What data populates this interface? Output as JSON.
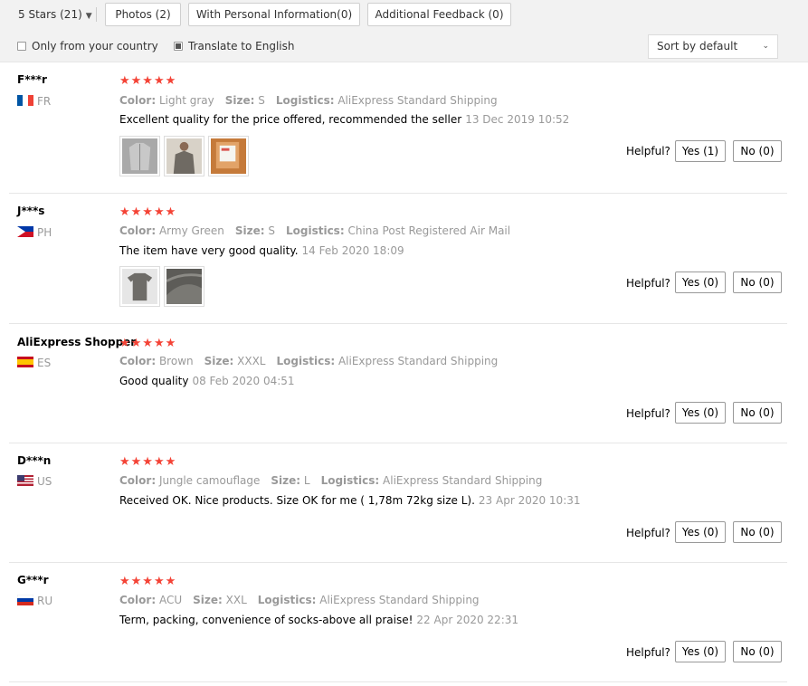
{
  "filters": {
    "star_filter": "5 Stars (21)",
    "buttons": [
      "Photos (2)",
      "With Personal Information(0)",
      "Additional Feedback (0)"
    ],
    "only_country": "Only from your country",
    "only_country_checked": false,
    "translate": "Translate to English",
    "translate_checked": true,
    "sort": "Sort by default"
  },
  "labels": {
    "color": "Color:",
    "size": "Size:",
    "logistics": "Logistics:",
    "helpful": "Helpful?"
  },
  "colors": {
    "star": "#f44336",
    "text_muted": "#999999"
  },
  "reviews": [
    {
      "name": "F***r",
      "country": "FR",
      "rating": 5,
      "stars": "★★★★★",
      "color": "Light gray",
      "size": "S",
      "logistics": "AliExpress Standard Shipping",
      "text": "Excellent quality for the price offered, recommended the seller",
      "date": "13 Dec 2019 10:52",
      "photos": [
        "photo-gray-jacket",
        "photo-person-sweater",
        "photo-package"
      ],
      "yes": "Yes (1)",
      "no": "No (0)"
    },
    {
      "name": "J***s",
      "country": "PH",
      "rating": 5,
      "stars": "★★★★★",
      "color": "Army Green",
      "size": "S",
      "logistics": "China Post Registered Air Mail",
      "text": "The item have very good quality.",
      "date": "14 Feb 2020 18:09",
      "photos": [
        "photo-gray-shirt",
        "photo-fabric-closeup"
      ],
      "yes": "Yes (0)",
      "no": "No (0)"
    },
    {
      "name": "AliExpress Shopper",
      "country": "ES",
      "rating": 5,
      "stars": "★★★★★",
      "color": "Brown",
      "size": "XXXL",
      "logistics": "AliExpress Standard Shipping",
      "text": "Good quality",
      "date": "08 Feb 2020 04:51",
      "photos": [],
      "yes": "Yes (0)",
      "no": "No (0)"
    },
    {
      "name": "D***n",
      "country": "US",
      "rating": 5,
      "stars": "★★★★★",
      "color": "Jungle camouflage",
      "size": "L",
      "logistics": "AliExpress Standard Shipping",
      "text": "Received OK. Nice products. Size OK for me ( 1,78m 72kg size L).",
      "date": "23 Apr 2020 10:31",
      "photos": [],
      "yes": "Yes (0)",
      "no": "No (0)"
    },
    {
      "name": "G***r",
      "country": "RU",
      "rating": 5,
      "stars": "★★★★★",
      "color": "ACU",
      "size": "XXL",
      "logistics": "AliExpress Standard Shipping",
      "text": "Term, packing, convenience of socks-above all praise!",
      "date": "22 Apr 2020 22:31",
      "photos": [],
      "yes": "Yes (0)",
      "no": "No (0)"
    }
  ]
}
